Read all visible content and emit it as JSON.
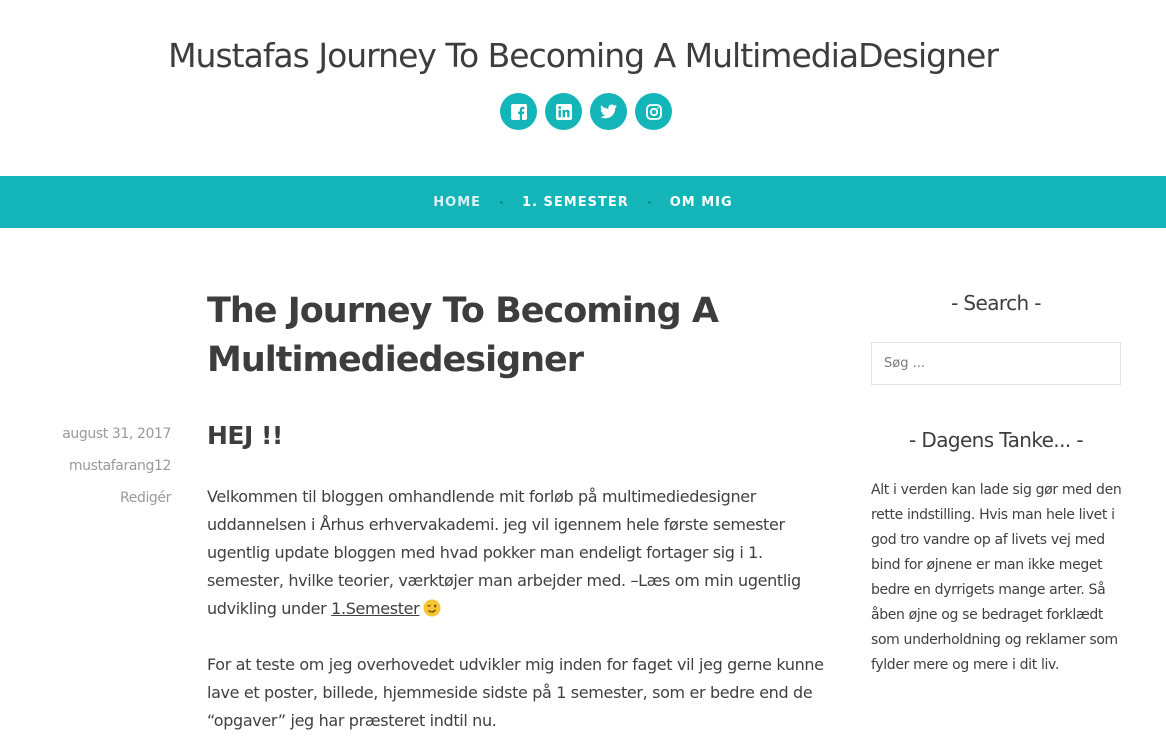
{
  "site": {
    "title": "Mustafas Journey To Becoming A MultimediaDesigner"
  },
  "social": [
    {
      "icon": "facebook-icon"
    },
    {
      "icon": "linkedin-icon"
    },
    {
      "icon": "twitter-icon"
    },
    {
      "icon": "instagram-icon"
    }
  ],
  "colors": {
    "accent": "#14b5b9"
  },
  "nav": {
    "items": [
      {
        "label": "HOME",
        "active": true
      },
      {
        "label": "1. SEMESTER",
        "active": false
      },
      {
        "label": "OM MIG",
        "active": false
      }
    ]
  },
  "post": {
    "title": "The Journey To Becoming A Multimediedesigner",
    "date": "august 31, 2017",
    "author": "mustafarang12",
    "edit_label": "Redigér",
    "heading": "HEJ !!",
    "p1_text": "Velkommen til bloggen omhandlende mit forløb på multimediedesigner uddannelsen i Århus erhvervakademi. jeg vil igennem hele første semester ugentlig update bloggen med hvad pokker man endeligt fortager sig i 1. semester, hvilke teorier, værktøjer man arbejder med. –Læs om min ugentlig udvikling under",
    "p1_link": "1.Semester",
    "p2_text": "For at teste om jeg overhovedet udvikler mig inden for faget vil jeg gerne kunne lave et poster, billede, hjemmeside sidste på 1 semester, som er bedre end de “opgaver” jeg har præsteret indtil nu."
  },
  "sidebar": {
    "search_title": "- Search -",
    "search_placeholder": "Søg ...",
    "tanke_title": "- Dagens Tanke... -",
    "tanke_text": "Alt i verden kan lade sig gør med den rette indstilling. Hvis man hele livet i god tro vandre op af livets vej med bind for øjnene er man ikke meget bedre en dyrrigets mange arter.  Så åben øjne og se bedraget forklædt som underholdning og reklamer som fylder mere og mere i dit liv."
  }
}
